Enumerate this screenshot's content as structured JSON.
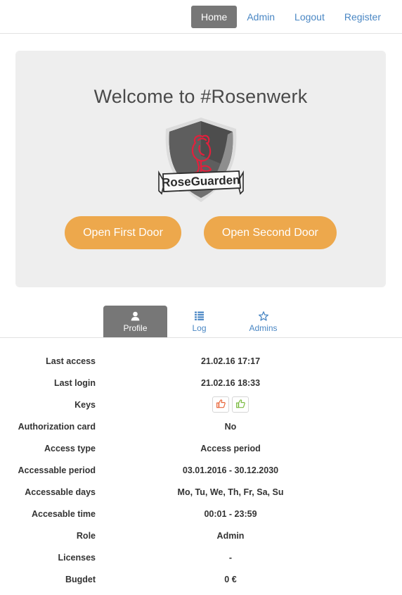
{
  "nav": {
    "items": [
      {
        "label": "Home",
        "active": true
      },
      {
        "label": "Admin",
        "active": false
      },
      {
        "label": "Logout",
        "active": false
      },
      {
        "label": "Register",
        "active": false
      }
    ]
  },
  "hero": {
    "title": "Welcome to #Rosenwerk",
    "logo_text": "RoseGuarden",
    "buttons": [
      {
        "label": "Open First Door"
      },
      {
        "label": "Open Second Door"
      }
    ],
    "panel_color": "#eeeeee",
    "button_color": "#eda84c"
  },
  "tabs": [
    {
      "label": "Profile",
      "icon": "user-icon",
      "active": true
    },
    {
      "label": "Log",
      "icon": "list-icon",
      "active": false
    },
    {
      "label": "Admins",
      "icon": "star-icon",
      "active": false
    }
  ],
  "profile": {
    "rows": [
      {
        "label": "Last access",
        "value": "21.02.16 17:17"
      },
      {
        "label": "Last login",
        "value": "21.02.16 18:33"
      },
      {
        "label": "Keys",
        "value": ""
      },
      {
        "label": "Authorization card",
        "value": "No"
      },
      {
        "label": "Access type",
        "value": "Access period"
      },
      {
        "label": "Accessable period",
        "value": "03.01.2016 - 30.12.2030"
      },
      {
        "label": "Accessable days",
        "value": "Mo, Tu, We, Th, Fr, Sa, Su"
      },
      {
        "label": "Accesable time",
        "value": "00:01 - 23:59"
      },
      {
        "label": "Role",
        "value": "Admin"
      },
      {
        "label": "Licenses",
        "value": "-"
      },
      {
        "label": "Bugdet",
        "value": "0 €"
      }
    ],
    "keys": [
      {
        "name": "key-first-door",
        "icon": "thumbs-up-icon",
        "color": "#e8663a"
      },
      {
        "name": "key-second-door",
        "icon": "thumbs-up-icon",
        "color": "#7cbb42"
      }
    ]
  },
  "colors": {
    "link": "#4a87c4",
    "active_tab_bg": "#777777",
    "accent_orange": "#eda84c"
  }
}
